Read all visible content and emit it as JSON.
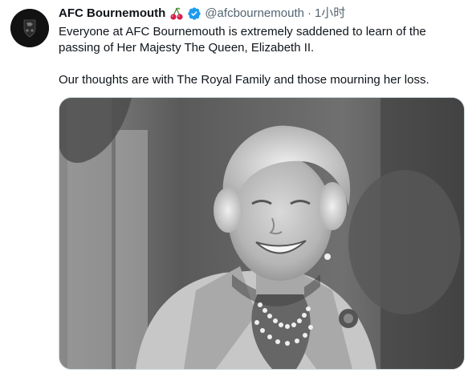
{
  "tweet": {
    "author_name": "AFC Bournemouth",
    "handle": "@afcbournemouth",
    "separator": "·",
    "time": "1小时",
    "text_line1": "Everyone at AFC Bournemouth is extremely saddened to learn of the passing of Her Majesty The Queen, Elizabeth II.",
    "text_line2": "Our thoughts are with The Royal Family and those mourning her loss."
  },
  "icons": {
    "name_emoji": "cherries-icon",
    "verified": "verified-badge-icon",
    "avatar": "club-crest-icon"
  },
  "colors": {
    "handle_gray": "#536471",
    "verified_blue": "#1d9bf0",
    "cherry_red": "#e0245e"
  }
}
